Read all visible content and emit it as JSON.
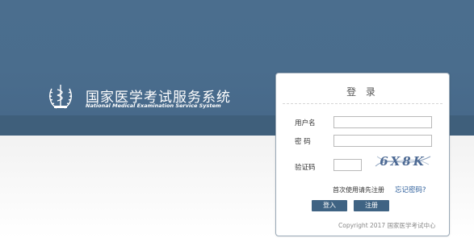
{
  "header": {
    "title_cn": "国家医学考试服务系统",
    "title_en": "National Medical Examination Service System",
    "logo_icon": "medical-emblem-icon"
  },
  "login": {
    "title": "登 录",
    "username_label": "用户名",
    "username_value": "",
    "password_label": "密  码",
    "password_value": "",
    "captcha_label": "验证码",
    "captcha_value": "",
    "captcha_text": "6X8K",
    "register_hint": "首次使用请先注册",
    "forgot_link": "忘记密码?",
    "login_button": "登入",
    "register_button": "注册",
    "copyright": "Copyright 2017 国家医学考试中心"
  },
  "colors": {
    "banner": "#4b6e8e",
    "band": "#3f5f7b",
    "button": "#3f6383",
    "link": "#2b5d9a"
  }
}
